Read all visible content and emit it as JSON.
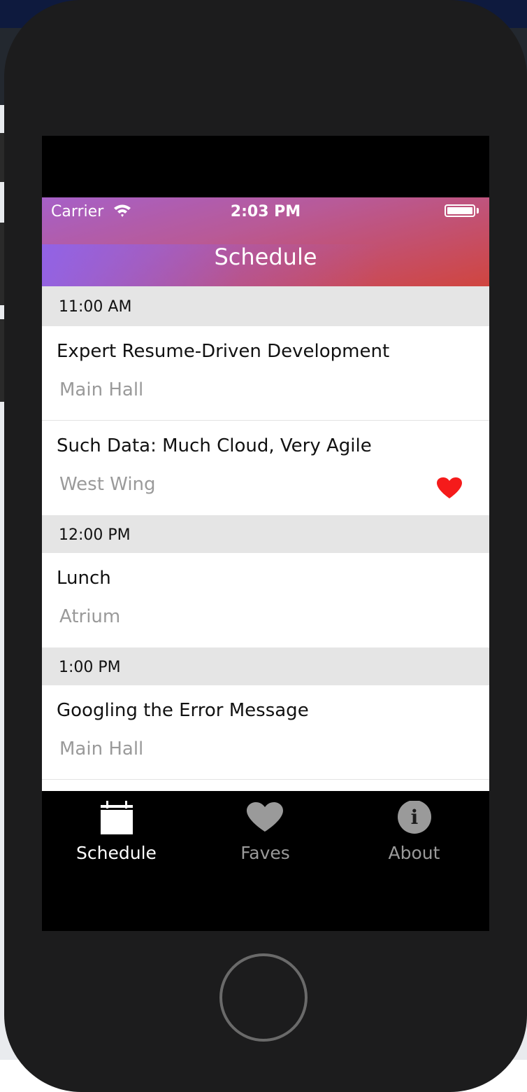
{
  "status_bar": {
    "carrier": "Carrier",
    "time": "2:03 PM"
  },
  "nav": {
    "title": "Schedule"
  },
  "sections": [
    {
      "time": "11:00 AM",
      "sessions": [
        {
          "title": "Expert Resume-Driven Development",
          "location": "Main Hall",
          "favorite": false
        },
        {
          "title": "Such Data: Much Cloud, Very Agile",
          "location": "West Wing",
          "favorite": true
        }
      ]
    },
    {
      "time": "12:00 PM",
      "sessions": [
        {
          "title": "Lunch",
          "location": "Atrium",
          "favorite": false
        }
      ]
    },
    {
      "time": "1:00 PM",
      "sessions": [
        {
          "title": "Googling the Error Message",
          "location": "Main Hall",
          "favorite": false
        }
      ]
    }
  ],
  "tabs": [
    {
      "label": "Schedule",
      "icon": "calendar-icon",
      "active": true
    },
    {
      "label": "Faves",
      "icon": "heart-icon",
      "active": false
    },
    {
      "label": "About",
      "icon": "info-icon",
      "active": false
    }
  ],
  "colors": {
    "favorite": "#f51b1b",
    "tab_active": "#ffffff",
    "tab_inactive": "#9a9a9a",
    "header_gradient_start": "#9a6ae8",
    "header_gradient_end": "#d0453f"
  }
}
